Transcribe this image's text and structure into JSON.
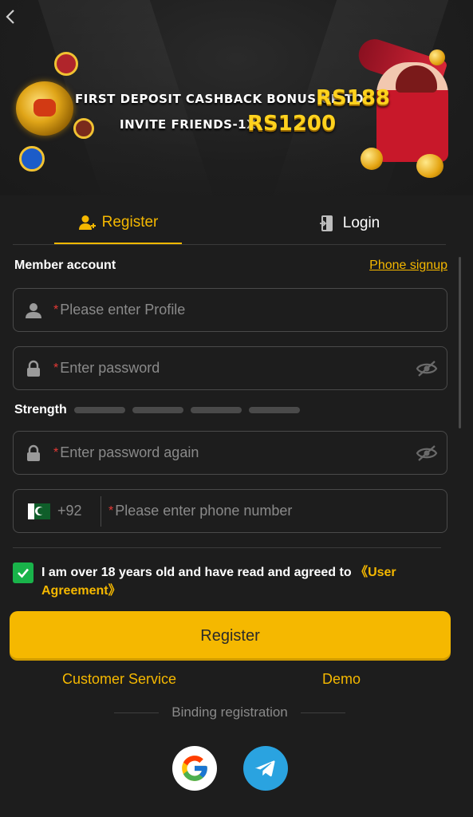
{
  "banner": {
    "line1": "FIRST DEPOSIT CASHBACK BONUS UP TO",
    "amount1": "RS188",
    "line2": "INVITE FRIENDS-1X",
    "amount2": "RS1200"
  },
  "tabs": [
    {
      "label": "Register",
      "active": true,
      "icon": "user-add-icon"
    },
    {
      "label": "Login",
      "active": false,
      "icon": "login-door-icon"
    }
  ],
  "form": {
    "member_label": "Member account",
    "phone_signup": "Phone signup",
    "required_mark": "*",
    "profile_placeholder": "Please enter Profile",
    "password_placeholder": "Enter password",
    "strength_label": "Strength",
    "password_again_placeholder": "Enter password again",
    "country_code": "+92",
    "phone_placeholder": "Please enter phone number",
    "agree_text": "I am over 18 years old and have read and agreed to",
    "agreement_link": "《User Agreement》",
    "agreed": true,
    "register_button": "Register"
  },
  "footer": {
    "customer_service": "Customer Service",
    "demo": "Demo",
    "binding": "Binding registration",
    "social": [
      "google-icon",
      "telegram-icon"
    ]
  },
  "colors": {
    "accent": "#f5b800",
    "background": "#1d1d1d",
    "checkbox": "#19b34a",
    "telegram": "#2aa3e0"
  }
}
